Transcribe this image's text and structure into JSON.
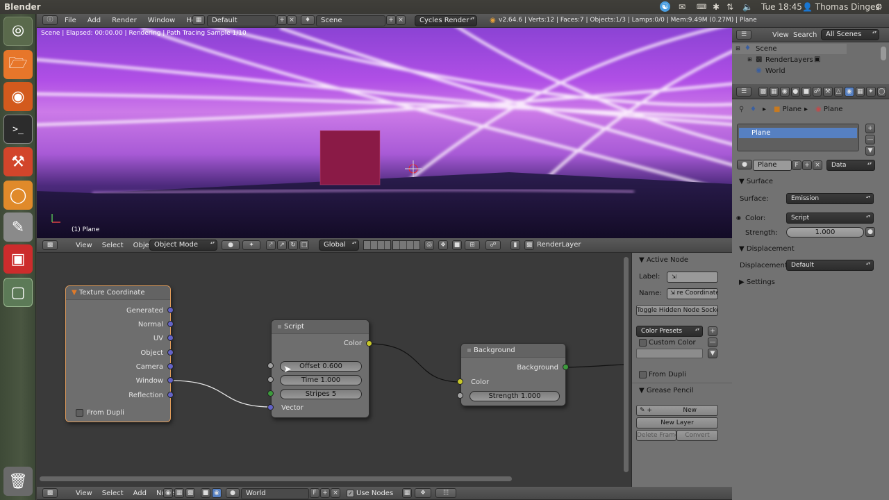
{
  "topbar": {
    "app": "Blender",
    "time": "Tue 18:45",
    "user": "Thomas Dinges"
  },
  "info": {
    "menus": [
      "File",
      "Add",
      "Render",
      "Window",
      "Help"
    ],
    "layout": "Default",
    "scene": "Scene",
    "engine": "Cycles Render",
    "stats": "v2.64.6 | Verts:12 | Faces:7 | Objects:1/3 | Lamps:0/0 | Mem:9.49M (0.27M) | Plane"
  },
  "viewport": {
    "status": "Scene | Elapsed: 00:00.00 | Rendering | Path Tracing Sample 1/10",
    "object": "(1) Plane",
    "menus": [
      "View",
      "Select",
      "Object"
    ],
    "mode": "Object Mode",
    "orientation": "Global",
    "render_layer": "RenderLayer"
  },
  "node_editor": {
    "menus": [
      "View",
      "Select",
      "Add",
      "Node"
    ],
    "world": "World",
    "use_nodes": "Use Nodes",
    "world_flag": "F",
    "texcoord": {
      "title": "Texture Coordinate",
      "outputs": [
        "Generated",
        "Normal",
        "UV",
        "Object",
        "Camera",
        "Window",
        "Reflection"
      ],
      "from_dupli": "From Dupli"
    },
    "script": {
      "title": "Script",
      "output": "Color",
      "offset": "Offset 0.600",
      "time": "Time 1.000",
      "stripes": "Stripes 5",
      "vector": "Vector"
    },
    "background": {
      "title": "Background",
      "output": "Background",
      "color": "Color",
      "strength": "Strength 1.000"
    }
  },
  "active_node": {
    "title": "Active Node",
    "label_lbl": "Label:",
    "name_lbl": "Name:",
    "name_val": "re Coordinate",
    "toggle": "Toggle Hidden Node Sockets",
    "color_presets": "Color Presets",
    "custom_color": "Custom Color",
    "from_dupli": "From Dupli",
    "grease": "Grease Pencil",
    "new": "New",
    "new_layer": "New Layer",
    "delete_frame": "Delete Frame",
    "convert": "Convert"
  },
  "outliner": {
    "view": "View",
    "search": "Search",
    "filter": "All Scenes",
    "items": [
      "Scene",
      "RenderLayers",
      "World"
    ]
  },
  "properties": {
    "crumb1": "Plane",
    "crumb2": "Plane",
    "slot": "Plane",
    "mat_name": "Plane",
    "mat_flag": "F",
    "data": "Data",
    "surface_hdr": "Surface",
    "surface_lbl": "Surface:",
    "surface_val": "Emission",
    "color_lbl": "Color:",
    "color_val": "Script",
    "strength_lbl": "Strength:",
    "strength_val": "1.000",
    "displacement_hdr": "Displacement",
    "displacement_lbl": "Displacement:",
    "displacement_val": "Default",
    "settings_hdr": "Settings"
  },
  "colors": {
    "socket_vector": "#6363c7",
    "socket_color": "#c7c729",
    "socket_float": "#a1a1a1",
    "selected_slot": "#5680c2"
  }
}
